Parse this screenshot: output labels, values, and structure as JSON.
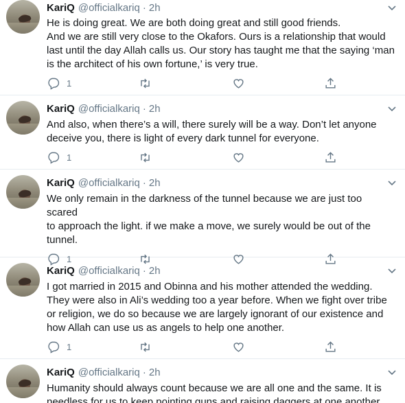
{
  "tweets": [
    {
      "name": "KariQ",
      "handle": "@officialkariq",
      "separator": "·",
      "time": "2h",
      "text_lines": [
        "He is doing great. We are both doing great and still good friends.",
        "And we are still very close to the Okafors. Ours is a relationship that would",
        "last until the day Allah calls us. Our story has taught me that the saying ‘man",
        "is the architect of his own fortune,’ is very true."
      ],
      "reply_count": "1"
    },
    {
      "name": "KariQ",
      "handle": "@officialkariq",
      "separator": "·",
      "time": "2h",
      "text_lines": [
        "And also, when there’s a will, there surely will be a way. Don’t let anyone",
        "deceive you, there is light of every dark tunnel for everyone."
      ],
      "reply_count": "1"
    },
    {
      "name": "KariQ",
      "handle": "@officialkariq",
      "separator": "·",
      "time": "2h",
      "text_lines": [
        "We only remain in the darkness of the tunnel because we are just too scared",
        "to approach the light. if we make a move, we surely would be out of the",
        "tunnel."
      ],
      "reply_count": "1"
    },
    {
      "name": "KariQ",
      "handle": "@officialkariq",
      "separator": "·",
      "time": "2h",
      "text_lines": [
        "I got married in 2015 and Obinna and his mother attended the wedding.",
        "They were also in Ali’s wedding too a year before. When we fight over tribe",
        "or religion, we do so because we are largely ignorant of our existence and",
        "how Allah can use us as angels to help one another."
      ],
      "reply_count": "1"
    },
    {
      "name": "KariQ",
      "handle": "@officialkariq",
      "separator": "·",
      "time": "2h",
      "text_lines": [
        "Humanity should always count because we are all one and the same. It is",
        "needless for us to keep pointing guns and raising daggers at one another."
      ]
    }
  ],
  "icons": {
    "reply": "reply-icon",
    "retweet": "retweet-icon",
    "like": "heart-icon",
    "share": "share-icon",
    "more": "chevron-down-icon"
  },
  "colors": {
    "text": "#14171a",
    "secondary": "#657786",
    "divider": "#e6ecf0"
  }
}
